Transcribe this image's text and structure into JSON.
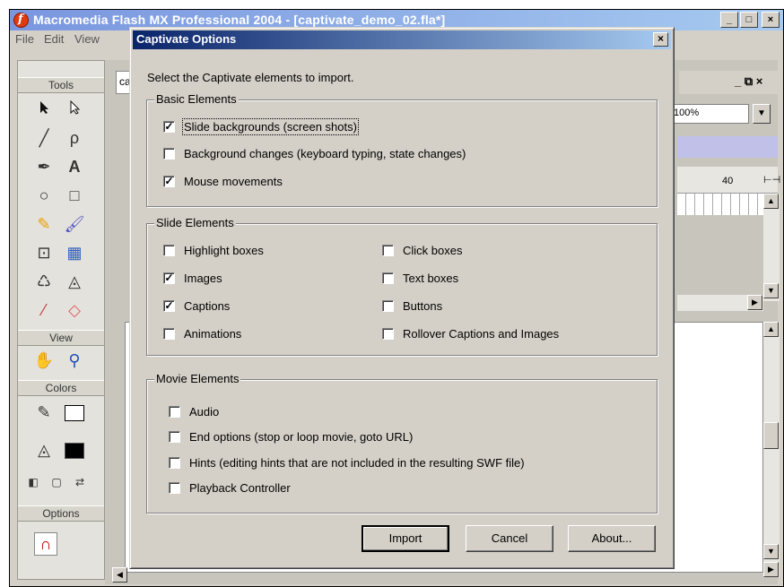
{
  "app": {
    "title": "Macromedia Flash MX Professional 2004 - [captivate_demo_02.fla*]",
    "menu": [
      "File",
      "Edit",
      "View"
    ],
    "window_controls": {
      "minimize": "_",
      "restore": "□",
      "close": "×"
    },
    "doc_tab_label": "ca",
    "doc_controls": "_ ⧉ ×",
    "zoom": "100%",
    "ruler_mark": "40"
  },
  "tools": {
    "header": "Tools",
    "view_label": "View",
    "colors_label": "Colors",
    "options_label": "Options",
    "icons": [
      "arrow-icon",
      "subselect-icon",
      "line-icon",
      "lasso-icon",
      "pen-icon",
      "text-icon",
      "oval-icon",
      "rect-icon",
      "pencil-icon",
      "brush-icon",
      "free-transform-icon",
      "fill-transform-icon",
      "ink-bottle-icon",
      "paint-bucket-icon",
      "eyedropper-icon",
      "eraser-icon"
    ]
  },
  "dialog": {
    "title": "Captivate Options",
    "close_label": "×",
    "instruction": "Select the Captivate elements to import.",
    "basic": {
      "legend": "Basic Elements",
      "items": [
        {
          "label": "Slide backgrounds (screen shots)",
          "checked": true
        },
        {
          "label": "Background changes (keyboard typing, state changes)",
          "checked": false
        },
        {
          "label": "Mouse movements",
          "checked": true
        }
      ]
    },
    "slide": {
      "legend": "Slide Elements",
      "left": [
        {
          "label": "Highlight boxes",
          "checked": false
        },
        {
          "label": "Images",
          "checked": true
        },
        {
          "label": "Captions",
          "checked": true
        },
        {
          "label": "Animations",
          "checked": false
        }
      ],
      "right": [
        {
          "label": "Click boxes",
          "checked": false
        },
        {
          "label": "Text boxes",
          "checked": false
        },
        {
          "label": "Buttons",
          "checked": false
        },
        {
          "label": "Rollover Captions and Images",
          "checked": false
        }
      ]
    },
    "movie": {
      "legend": "Movie Elements",
      "items": [
        {
          "label": "Audio",
          "checked": false
        },
        {
          "label": "End options (stop or loop movie, goto URL)",
          "checked": false
        },
        {
          "label": "Hints (editing hints that are not included in the resulting SWF file)",
          "checked": false
        },
        {
          "label": "Playback Controller",
          "checked": false
        }
      ]
    },
    "buttons": {
      "import": "Import",
      "cancel": "Cancel",
      "about": "About..."
    }
  }
}
